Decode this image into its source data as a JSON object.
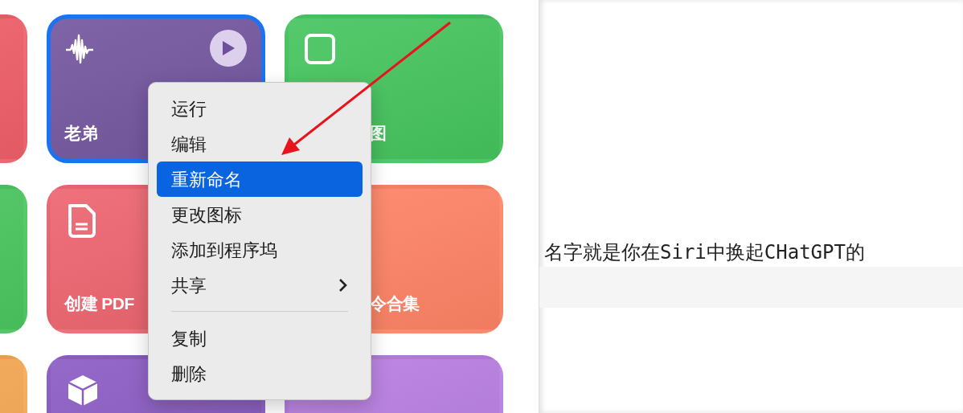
{
  "tiles": [
    {
      "color": "#f0606a",
      "selected": false
    },
    {
      "title": "老弟",
      "color": "#7457a0",
      "selected": true
    },
    {
      "title": "图",
      "color": "#46c55f",
      "selected": false
    },
    {
      "color": "#4cc760",
      "selected": false
    },
    {
      "title": "创建 PDF",
      "color": "#ee6570",
      "selected": false
    },
    {
      "title": "令合集",
      "color": "#ff8466",
      "selected": false
    },
    {
      "color": "#f6a855",
      "selected": false
    },
    {
      "color": "#8b5cc4",
      "selected": false
    },
    {
      "color": "#b87ee2",
      "selected": false
    }
  ],
  "menu": {
    "sections": [
      [
        {
          "label": "运行",
          "selected": false,
          "submenu": false
        },
        {
          "label": "编辑",
          "selected": false,
          "submenu": false
        },
        {
          "label": "重新命名",
          "selected": true,
          "submenu": false
        },
        {
          "label": "更改图标",
          "selected": false,
          "submenu": false
        },
        {
          "label": "添加到程序坞",
          "selected": false,
          "submenu": false
        },
        {
          "label": "共享",
          "selected": false,
          "submenu": true
        }
      ],
      [
        {
          "label": "复制",
          "selected": false,
          "submenu": false
        },
        {
          "label": "删除",
          "selected": false,
          "submenu": false
        }
      ]
    ]
  },
  "editor": {
    "text": "名字就是你在Siri中换起CHatGPT的"
  }
}
